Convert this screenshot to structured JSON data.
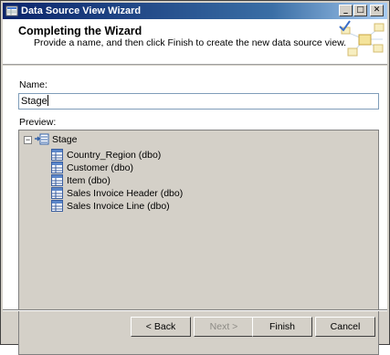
{
  "window": {
    "title": "Data Source View Wizard",
    "controls": {
      "minimize": "_",
      "maximize": "□",
      "close": "✕"
    }
  },
  "header": {
    "title": "Completing the Wizard",
    "subtitle": "Provide a name, and then click Finish to create the new data source view."
  },
  "form": {
    "name_label": "Name:",
    "name_value": "Stage",
    "preview_label": "Preview:"
  },
  "tree": {
    "expander": "−",
    "root": "Stage",
    "items": [
      "Country_Region (dbo)",
      "Customer (dbo)",
      "Item (dbo)",
      "Sales Invoice Header (dbo)",
      "Sales Invoice Line (dbo)"
    ]
  },
  "buttons": {
    "back": "< Back",
    "next": "Next >",
    "finish": "Finish",
    "cancel": "Cancel"
  },
  "icons": {
    "window": "data-source-view-icon",
    "root": "data-source-view-icon",
    "item": "table-icon"
  }
}
